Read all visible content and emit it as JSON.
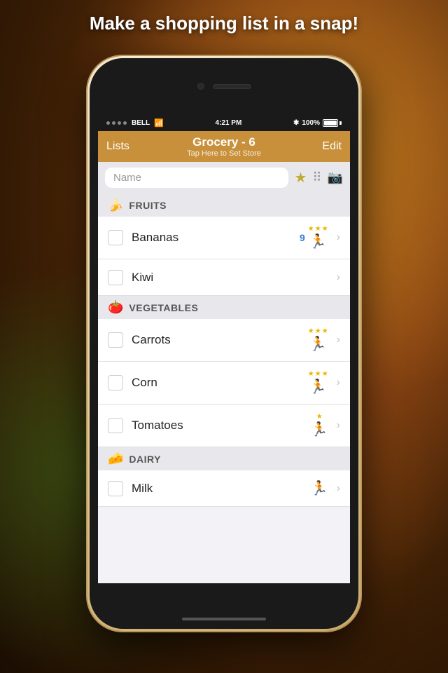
{
  "background": {
    "color": "#2a1a08"
  },
  "headline": "Make a shopping list in a snap!",
  "statusBar": {
    "carrier": "BELL",
    "time": "4:21 PM",
    "battery": "100%",
    "bluetooth": true
  },
  "navBar": {
    "title": "Grocery - 6",
    "subtitle": "Tap Here to Set Store",
    "leftBtn": "Lists",
    "rightBtn": "Edit"
  },
  "searchBar": {
    "placeholder": "Name",
    "starIcon": "⭐",
    "barcodeIcon": "barcode",
    "cameraIcon": "camera"
  },
  "categories": [
    {
      "id": "fruits",
      "emoji": "🍌",
      "label": "FRUITS",
      "items": [
        {
          "id": "bananas",
          "name": "Bananas",
          "badge": "9",
          "stars": 3,
          "hasRunner": true,
          "runnerColor": "blue"
        },
        {
          "id": "kiwi",
          "name": "Kiwi",
          "badge": "",
          "stars": 0,
          "hasRunner": false
        }
      ]
    },
    {
      "id": "vegetables",
      "emoji": "🍅",
      "label": "VEGETABLES",
      "items": [
        {
          "id": "carrots",
          "name": "Carrots",
          "badge": "",
          "stars": 3,
          "hasRunner": true,
          "runnerColor": "blue"
        },
        {
          "id": "corn",
          "name": "Corn",
          "badge": "",
          "stars": 3,
          "hasRunner": true,
          "runnerColor": "blue"
        },
        {
          "id": "tomatoes",
          "name": "Tomatoes",
          "badge": "",
          "stars": 1,
          "hasRunner": true,
          "runnerColor": "blue"
        }
      ]
    },
    {
      "id": "dairy",
      "emoji": "🧀",
      "label": "DAIRY",
      "items": [
        {
          "id": "milk",
          "name": "Milk",
          "badge": "",
          "stars": 0,
          "hasRunner": true,
          "runnerColor": "gray"
        }
      ]
    }
  ]
}
